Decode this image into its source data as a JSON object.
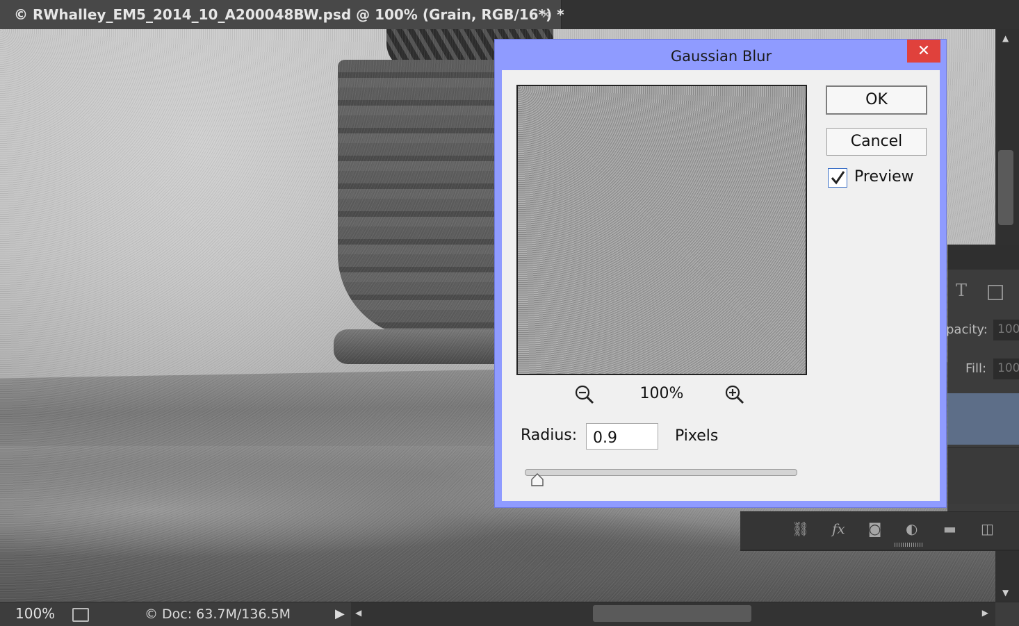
{
  "document": {
    "tab_title": "© RWhalley_EM5_2014_10_A200048BW.psd @ 100% (Grain, RGB/16*) *",
    "close_glyph": "×"
  },
  "status_bar": {
    "zoom": "100%",
    "doc_info": "© Doc: 63.7M/136.5M"
  },
  "layers_panel": {
    "opacity_label": "pacity:",
    "opacity_value": "100",
    "fill_label": "Fill:",
    "fill_value": "100"
  },
  "dialog": {
    "title": "Gaussian Blur",
    "close_glyph": "✕",
    "ok_label": "OK",
    "cancel_label": "Cancel",
    "preview_label": "Preview",
    "preview_checked": true,
    "preview_zoom": "100%",
    "radius_label": "Radius:",
    "radius_value": "0.9",
    "radius_units": "Pixels"
  },
  "colors": {
    "dialog_frame": "#8f9bff",
    "dialog_close": "#e0413c",
    "selected_layer": "#5d6e88"
  }
}
